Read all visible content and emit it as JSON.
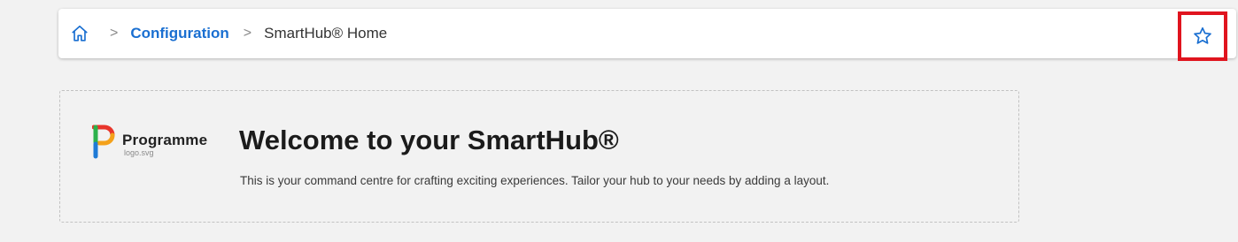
{
  "breadcrumb": {
    "home_icon": "home-icon",
    "separator": ">",
    "items": [
      {
        "label": "Configuration"
      },
      {
        "label": "SmartHub® Home"
      }
    ],
    "favorite_icon": "star-outline-icon"
  },
  "colors": {
    "accent": "#1a6fd1",
    "highlight_border": "#e0141e",
    "logo_red": "#e8352b",
    "logo_orange": "#f4a11a",
    "logo_green": "#2bb24c",
    "logo_blue": "#1f7bd6"
  },
  "welcome": {
    "logo_text": "Programme",
    "logo_subtext": "logo.svg",
    "title": "Welcome to your SmartHub®",
    "description": "This is your command centre for crafting exciting experiences. Tailor your hub to your needs by adding a layout."
  }
}
